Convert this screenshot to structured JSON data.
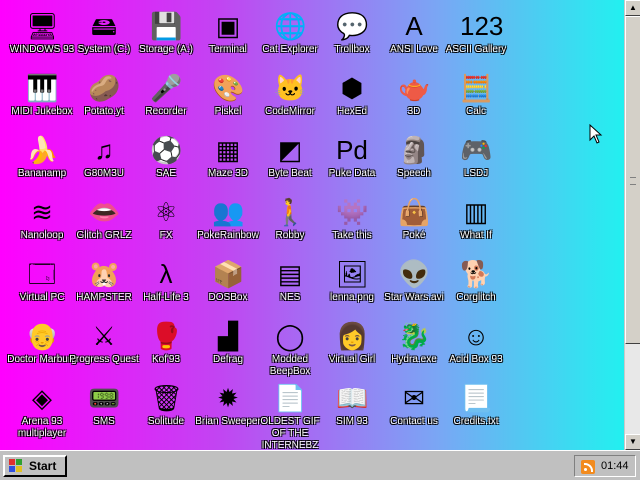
{
  "desktop": {
    "icons": [
      {
        "label": "WINDOWS 93",
        "icon": "computer-icon",
        "glyph": "🖥"
      },
      {
        "label": "System (C:)",
        "icon": "hard-drive-icon",
        "glyph": "🖴"
      },
      {
        "label": "Storage (A:)",
        "icon": "floppy-drive-icon",
        "glyph": "💾"
      },
      {
        "label": "Terminal",
        "icon": "terminal-icon",
        "glyph": "▣"
      },
      {
        "label": "Cat Explorer",
        "icon": "cat-globe-icon",
        "glyph": "🌐"
      },
      {
        "label": "Trollbox",
        "icon": "chat-bubble-icon",
        "glyph": "💬"
      },
      {
        "label": "ANSI Love",
        "icon": "ansi-letter-icon",
        "glyph": "A"
      },
      {
        "label": "ASCII Gallery",
        "icon": "ascii-numbers-icon",
        "glyph": "123"
      },
      {
        "label": "MIDI Jukebox",
        "icon": "piano-keys-icon",
        "glyph": "🎹"
      },
      {
        "label": "Potato.yt",
        "icon": "potato-icon",
        "glyph": "🥔"
      },
      {
        "label": "Recorder",
        "icon": "microphone-icon",
        "glyph": "🎤"
      },
      {
        "label": "Piskel",
        "icon": "paint-palette-icon",
        "glyph": "🎨"
      },
      {
        "label": "CodeMirror",
        "icon": "code-cat-icon",
        "glyph": "🐱"
      },
      {
        "label": "HexEd",
        "icon": "hex-cube-icon",
        "glyph": "⬢"
      },
      {
        "label": "3D",
        "icon": "teapot-icon",
        "glyph": "🫖"
      },
      {
        "label": "Calc",
        "icon": "calculator-icon",
        "glyph": "🧮"
      },
      {
        "label": "Bananamp",
        "icon": "banana-icon",
        "glyph": "🍌"
      },
      {
        "label": "G80M3U",
        "icon": "playlist-icon",
        "glyph": "♫"
      },
      {
        "label": "SAE",
        "icon": "boing-ball-icon",
        "glyph": "⚽"
      },
      {
        "label": "Maze 3D",
        "icon": "maze-icon",
        "glyph": "▦"
      },
      {
        "label": "Byte Beat",
        "icon": "waveform-icon",
        "glyph": "◩"
      },
      {
        "label": "Puke Data",
        "icon": "pd-patch-icon",
        "glyph": "Pd"
      },
      {
        "label": "Speech",
        "icon": "talking-face-icon",
        "glyph": "🗿"
      },
      {
        "label": "LSDJ",
        "icon": "gameboy-icon",
        "glyph": "🎮"
      },
      {
        "label": "Nanoloop",
        "icon": "oscilloscope-icon",
        "glyph": "≋"
      },
      {
        "label": "Glitch GRLZ",
        "icon": "lips-icon",
        "glyph": "👄"
      },
      {
        "label": "FX",
        "icon": "atom-icon",
        "glyph": "⚛"
      },
      {
        "label": "PokeRainbow",
        "icon": "pixel-people-icon",
        "glyph": "👥"
      },
      {
        "label": "Robby",
        "icon": "stick-figure-icon",
        "glyph": "🚶"
      },
      {
        "label": "Take this",
        "icon": "mario-icon",
        "glyph": "👾"
      },
      {
        "label": "Poké",
        "icon": "poke-bag-icon",
        "glyph": "👜"
      },
      {
        "label": "What If",
        "icon": "barcode-window-icon",
        "glyph": "▥"
      },
      {
        "label": "Virtual PC",
        "icon": "virtual-pc-window-icon",
        "glyph": "🗔"
      },
      {
        "label": "HAMPSTER",
        "icon": "hamster-icon",
        "glyph": "🐹"
      },
      {
        "label": "Half-Life 3",
        "icon": "lambda-icon",
        "glyph": "λ"
      },
      {
        "label": "DOSBox",
        "icon": "dosbox-crate-icon",
        "glyph": "📦"
      },
      {
        "label": "NES",
        "icon": "nes-console-icon",
        "glyph": "▤"
      },
      {
        "label": "lenna.png",
        "icon": "image-file-icon",
        "glyph": "🖼"
      },
      {
        "label": "Star Wars.avi",
        "icon": "yoda-icon",
        "glyph": "👽"
      },
      {
        "label": "Corglitch",
        "icon": "corgi-icon",
        "glyph": "🐕"
      },
      {
        "label": "Doctor Marburg",
        "icon": "doctor-face-icon",
        "glyph": "👴"
      },
      {
        "label": "Progress Quest",
        "icon": "crossed-swords-icon",
        "glyph": "⚔"
      },
      {
        "label": "Kof'93",
        "icon": "fighter-face-icon",
        "glyph": "🥊"
      },
      {
        "label": "Defrag",
        "icon": "defrag-blocks-icon",
        "glyph": "▟"
      },
      {
        "label": "Modded BeepBox",
        "icon": "green-ring-icon",
        "glyph": "◯"
      },
      {
        "label": "Virtual Girl",
        "icon": "woman-face-icon",
        "glyph": "👩"
      },
      {
        "label": "Hydra.exe",
        "icon": "hydra-icon",
        "glyph": "🐉"
      },
      {
        "label": "Acid Box 93",
        "icon": "smiley-icon",
        "glyph": "☺"
      },
      {
        "label": "Arena 93 multiplayer",
        "icon": "cube-icon",
        "glyph": "◈"
      },
      {
        "label": "SMS",
        "icon": "sms-console-icon",
        "glyph": "📟"
      },
      {
        "label": "Solitude",
        "icon": "trash-bin-icon",
        "glyph": "🗑"
      },
      {
        "label": "Brian Sweeper",
        "icon": "mine-icon",
        "glyph": "✹"
      },
      {
        "label": "OLDEST GIF OF THE INTERNEBZ",
        "icon": "gif-file-icon",
        "glyph": "📄"
      },
      {
        "label": "SIM 93",
        "icon": "book-icon",
        "glyph": "📖"
      },
      {
        "label": "Contact us",
        "icon": "letter-icon",
        "glyph": "✉"
      },
      {
        "label": "Credits.txt",
        "icon": "text-file-icon",
        "glyph": "📃"
      }
    ],
    "cursor": {
      "icon": "mouse-pointer-icon"
    }
  },
  "scrollbar": {
    "up_label": "▲",
    "down_label": "▼"
  },
  "taskbar": {
    "start_label": "Start",
    "tray": {
      "rss_icon": "rss-feed-icon",
      "clock": "01:44"
    }
  },
  "colors": {
    "gradient_left": "#ff00ff",
    "gradient_right": "#22f0f0",
    "taskbar": "#c0c0c0"
  }
}
